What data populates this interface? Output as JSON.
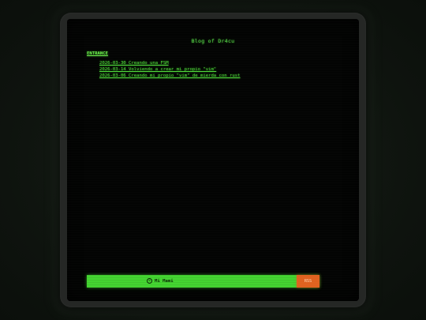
{
  "blog": {
    "title": "Blog of Dr4cu"
  },
  "section": {
    "heading": "ENTRANCE"
  },
  "posts": [
    {
      "label": "2026-03-30 Creando una FSM"
    },
    {
      "label": "2026-03-14 Volviendo a crear mi propio \"vim\""
    },
    {
      "label": "2026-03-06 Creando mi propio \"vim\" de mierda con rust"
    }
  ],
  "footer": {
    "copyright_icon": "©",
    "author": "Mi Mami",
    "rss_label": "RSS"
  },
  "colors": {
    "terminal_green": "#4fdc3a",
    "status_bar_green": "#44d631",
    "rss_orange": "#e0621f",
    "screen_black": "#030403"
  }
}
